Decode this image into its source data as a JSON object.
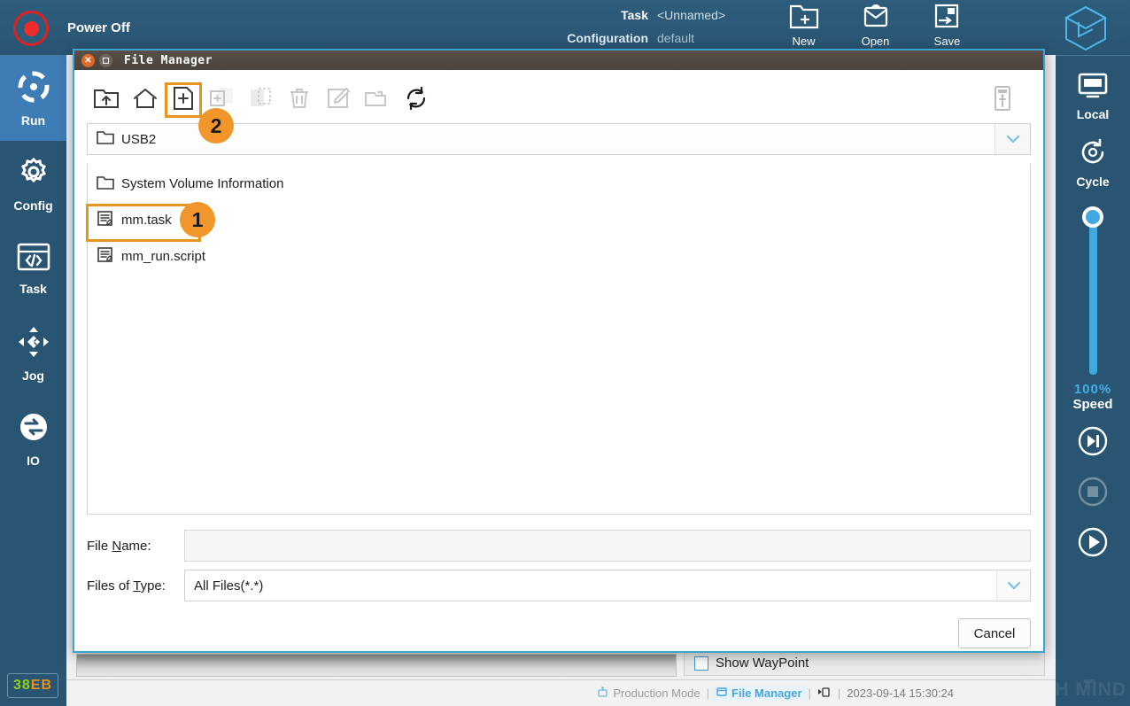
{
  "colors": {
    "accent_blue": "#3d7cb4",
    "panel_blue": "#2a5572",
    "marker_orange": "#f0962a",
    "highlight_orange": "#e8941f",
    "dialog_border": "#3ba2d4",
    "slider_blue": "#3fa9e0"
  },
  "topbar": {
    "power_label": "Power Off",
    "power_icon": "power-icon",
    "task_key": "Task",
    "task_value": "<Unnamed>",
    "config_key": "Configuration",
    "config_value": "default",
    "buttons": [
      {
        "label": "New",
        "icon": "new-file-icon"
      },
      {
        "label": "Open",
        "icon": "open-envelope-icon"
      },
      {
        "label": "Save",
        "icon": "save-disk-icon"
      }
    ],
    "brand_icon": "cube-logo-icon"
  },
  "sidebar": {
    "items": [
      {
        "label": "Run",
        "icon": "run-target-icon",
        "active": true
      },
      {
        "label": "Config",
        "icon": "gear-icon",
        "active": false
      },
      {
        "label": "Task",
        "icon": "code-window-icon",
        "active": false
      },
      {
        "label": "Jog",
        "icon": "move-arrows-icon",
        "active": false
      },
      {
        "label": "IO",
        "icon": "io-exchange-icon",
        "active": false
      }
    ]
  },
  "rightpanel": {
    "local_label": "Local",
    "local_icon": "monitor-icon",
    "cycle_label": "Cycle",
    "cycle_icon": "cycle-refresh-icon",
    "speed_value": "100%",
    "speed_label": "Speed",
    "slider_percent": 100,
    "controls": [
      {
        "name": "step-forward-button",
        "icon": "step-forward-icon",
        "disabled": false
      },
      {
        "name": "stop-button",
        "icon": "stop-square-icon",
        "disabled": true
      },
      {
        "name": "play-button",
        "icon": "play-triangle-icon",
        "disabled": false
      }
    ]
  },
  "dialog": {
    "title": "File Manager",
    "close_icon": "close-icon",
    "maximize_icon": "maximize-icon",
    "toolbar": [
      {
        "name": "parent-directory-button",
        "icon": "folder-up-icon",
        "disabled": false,
        "selected": false
      },
      {
        "name": "home-button",
        "icon": "home-icon",
        "disabled": false,
        "selected": false
      },
      {
        "name": "new-folder-button",
        "icon": "new-file-plus-icon",
        "disabled": false,
        "selected": true
      },
      {
        "name": "copy-button",
        "icon": "copy-icon",
        "disabled": true,
        "selected": false
      },
      {
        "name": "paste-button",
        "icon": "paste-icon",
        "disabled": true,
        "selected": false
      },
      {
        "name": "delete-button",
        "icon": "trash-icon",
        "disabled": true,
        "selected": false
      },
      {
        "name": "rename-button",
        "icon": "edit-pencil-icon",
        "disabled": true,
        "selected": false
      },
      {
        "name": "open-folder-button",
        "icon": "open-folder-icon",
        "disabled": true,
        "selected": false
      },
      {
        "name": "refresh-button",
        "icon": "refresh-icon",
        "disabled": false,
        "selected": false
      }
    ],
    "usb_device_icon": "usb-device-icon",
    "path_value": "USB2",
    "path_icon": "folder-icon",
    "path_dropdown_icon": "chevron-down-icon",
    "files": [
      {
        "name": "System Volume Information",
        "type": "folder",
        "icon": "folder-icon",
        "selected": false
      },
      {
        "name": "mm.task",
        "type": "file",
        "icon": "task-file-icon",
        "selected": true
      },
      {
        "name": "mm_run.script",
        "type": "file",
        "icon": "script-file-icon",
        "selected": false
      }
    ],
    "file_name_label": "File Name:",
    "file_name_label_mnemonic": "N",
    "file_name_value": "",
    "file_name_placeholder": "",
    "file_type_label": "Files of Type:",
    "file_type_label_mnemonic": "T",
    "file_type_value": "All Files(*.*)",
    "file_type_dropdown_icon": "chevron-down-icon",
    "cancel_label": "Cancel"
  },
  "background": {
    "show_waypoint_label": "Show WayPoint",
    "show_waypoint_checked": false
  },
  "statusbar": {
    "badge": {
      "part1": "38",
      "part2": "EB",
      "full": "38EB"
    },
    "production_mode": "Production Mode",
    "production_icon": "robot-icon",
    "active_window": "File Manager",
    "active_window_icon": "window-icon",
    "network_icon": "network-icon",
    "timestamp": "2023-09-14 15:30:24",
    "separator": "|"
  },
  "markers": [
    {
      "id": "1",
      "target": "mm.task file row"
    },
    {
      "id": "2",
      "target": "new file toolbar button"
    }
  ],
  "watermark": {
    "text": "TECH MIND"
  }
}
